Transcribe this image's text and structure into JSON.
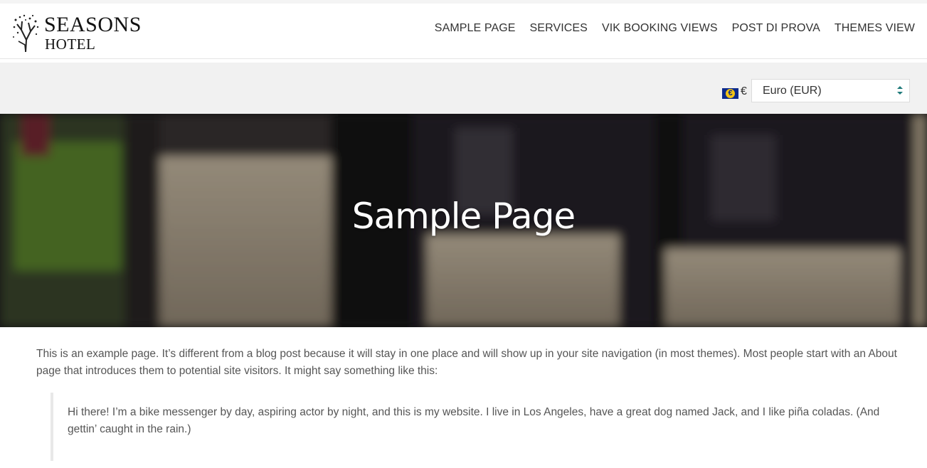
{
  "brand": {
    "line1": "SEASONS",
    "line2": "HOTEL"
  },
  "nav": {
    "items": [
      {
        "label": "SAMPLE PAGE"
      },
      {
        "label": "SERVICES"
      },
      {
        "label": "VIK BOOKING VIEWS"
      },
      {
        "label": "POST DI PROVA"
      },
      {
        "label": "THEMES VIEW"
      }
    ]
  },
  "currency": {
    "symbol": "€",
    "flag_glyph": "€",
    "selected": "Euro (EUR)",
    "flag_icon": "eu-flag-icon"
  },
  "hero": {
    "title": "Sample Page"
  },
  "content": {
    "intro": "This is an example page. It’s different from a blog post because it will stay in one place and will show up in your site navigation (in most themes). Most people start with an About page that introduces them to potential site visitors. It might say something like this:",
    "quote": "Hi there! I’m a bike messenger by day, aspiring actor by night, and this is my website. I live in Los Angeles, have a great dog named Jack, and I like piña coladas. (And gettin’ caught in the rain.)"
  },
  "colors": {
    "nav_text": "#333333",
    "currency_bar": "#f1f1f1",
    "hero_title": "#ffffff"
  }
}
